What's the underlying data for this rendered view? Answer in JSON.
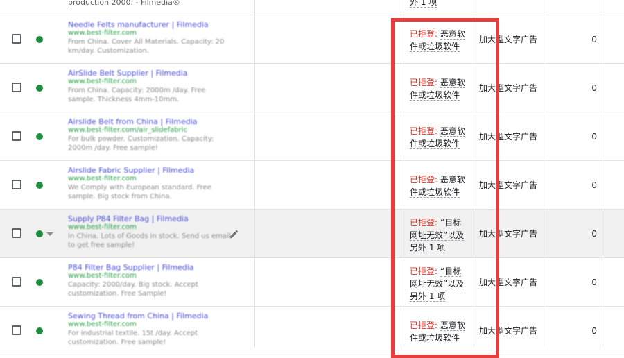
{
  "top_row": {
    "desc": "production 2000. - Filmedia®",
    "status_tail": "外 1 项"
  },
  "rejected_label": "已拒登:",
  "rows": [
    {
      "headline": "Needle Felts manufacturer | Filmedia",
      "url": "www.best-filter.com",
      "desc": "From China. Cover All Materials. Capacity: 20 km/day. Customization.",
      "reason": "恶意软件或垃圾软件",
      "ad_type": "加大型文字广告",
      "value": "0"
    },
    {
      "headline": "AirSlide Belt Supplier | Filmedia",
      "url": "www.best-filter.com",
      "desc": "From China. Capacity: 2000m /day. Free sample. Thickness 4mm-10mm.",
      "reason": "恶意软件或垃圾软件",
      "ad_type": "加大型文字广告",
      "value": "0"
    },
    {
      "headline": "Airslide Belt from China | Filmedia",
      "url": "www.best-filter.com/air_slidefabric",
      "desc": "For bulk powder. Customization. Capacity: 2000m /day. Free sample!",
      "reason": "恶意软件或垃圾软件",
      "ad_type": "加大型文字广告",
      "value": "0"
    },
    {
      "headline": "Airslide Fabric Supplier | Filmedia",
      "url": "www.best-filter.com",
      "desc": "We Comply with European standard. Free sample. Big stock from China.",
      "reason": "恶意软件或垃圾软件",
      "ad_type": "加大型文字广告",
      "value": "0"
    },
    {
      "headline": "Supply P84 Filter Bag | Filmedia",
      "url": "www.best-filter.com",
      "desc": "In China. Lots of Goods in stock. Send us email to get free sample!",
      "reason": "“目标网址无效”以及另外 1 项",
      "ad_type": "加大型文字广告",
      "value": "0"
    },
    {
      "headline": "P84 Filter Bag Supplier | Filmedia",
      "url": "www.best-filter.com",
      "desc": "Capacity: 2000/day. Big stock. Accept customization. Free Sample!",
      "reason": "“目标网址无效”以及另外 1 项",
      "ad_type": "加大型文字广告",
      "value": "0"
    },
    {
      "headline": "Sewing Thread from China | Filmedia",
      "url": "www.best-filter.com",
      "desc": "For industrial textile. 15t /day. Accept customization. Free sample!",
      "reason": "恶意软件或垃圾软件",
      "ad_type": "加大型文字广告",
      "value": "0"
    }
  ],
  "colors": {
    "rejected": "#d93025",
    "enabled_dot": "#1e8e3e",
    "highlight_box": "#e63d3d"
  }
}
